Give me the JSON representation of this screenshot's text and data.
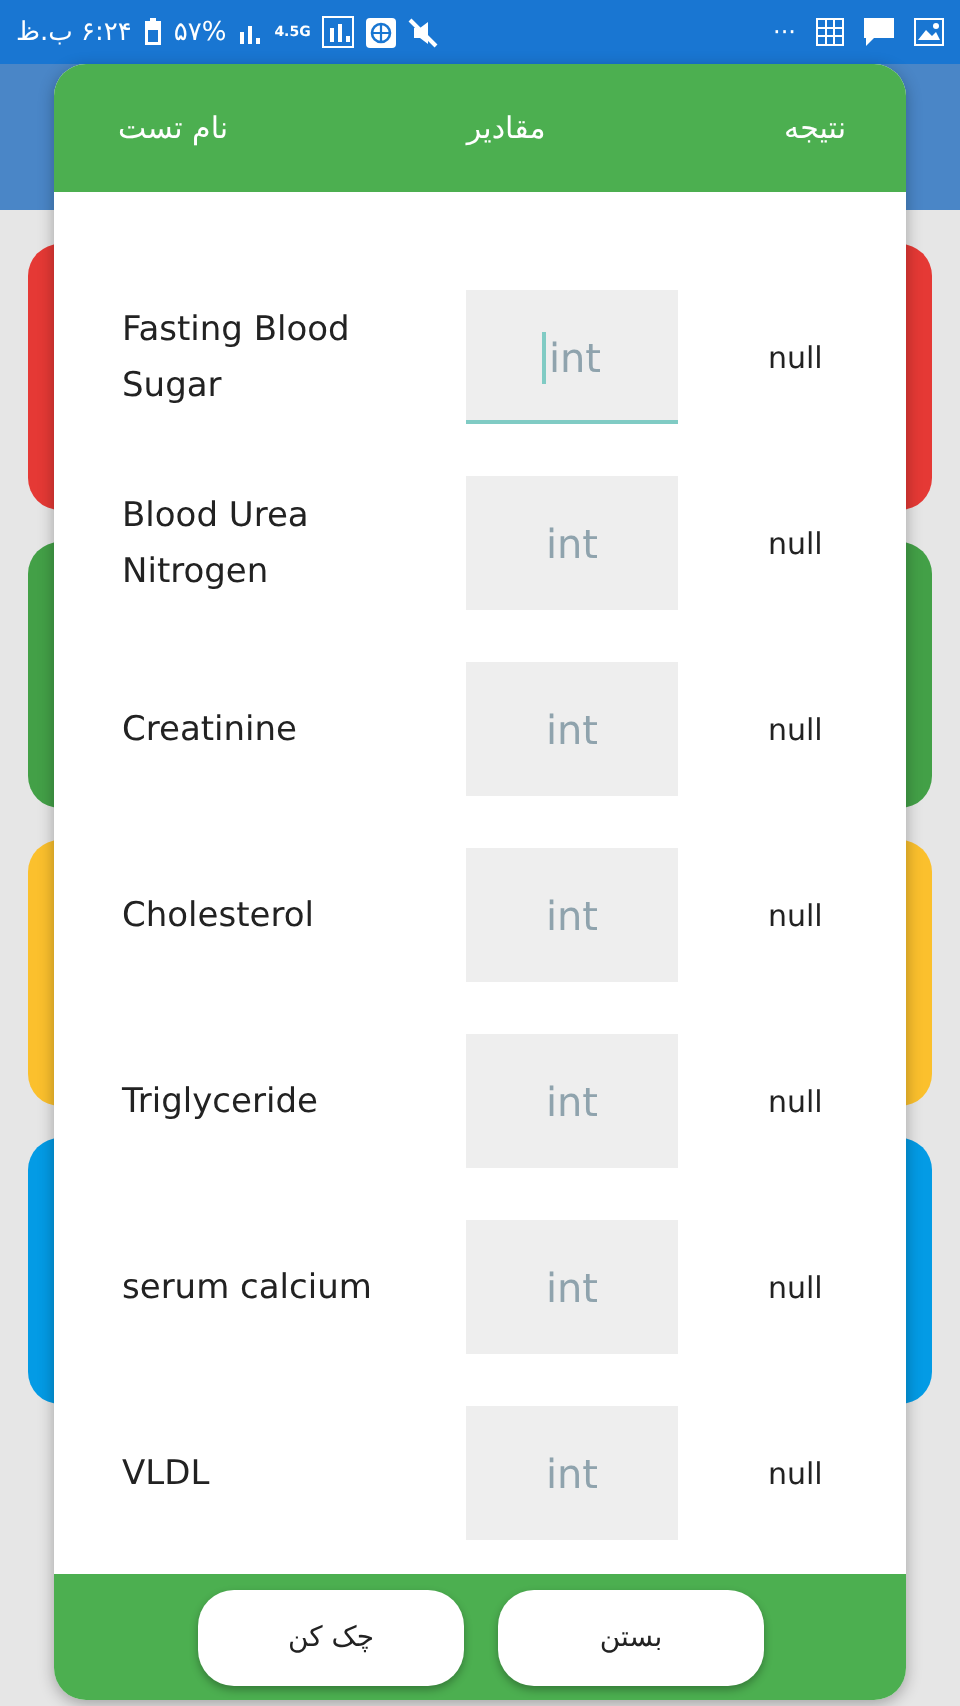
{
  "status_bar": {
    "time": "۶:۲۴ ب.ظ",
    "battery": "۵۷%",
    "network": "4.5G",
    "more": "···"
  },
  "background_cards": [
    {
      "color": "#e53935"
    },
    {
      "color": "#43a047"
    },
    {
      "color": "#fbc02d"
    },
    {
      "color": "#039be5"
    }
  ],
  "dialog": {
    "columns": [
      "نتیجه",
      "مقادیر",
      "نام تست"
    ],
    "rows": [
      {
        "name": "Fasting Blood Sugar",
        "placeholder": "int",
        "focused": true,
        "result": "null"
      },
      {
        "name": "Blood Urea Nitrogen",
        "placeholder": "int",
        "focused": false,
        "result": "null"
      },
      {
        "name": "Creatinine",
        "placeholder": "int",
        "focused": false,
        "result": "null"
      },
      {
        "name": "Cholesterol",
        "placeholder": "int",
        "focused": false,
        "result": "null"
      },
      {
        "name": "Triglyceride",
        "placeholder": "int",
        "focused": false,
        "result": "null"
      },
      {
        "name": "serum calcium",
        "placeholder": "int",
        "focused": false,
        "result": "null"
      },
      {
        "name": "VLDL",
        "placeholder": "int",
        "focused": false,
        "result": "null"
      }
    ],
    "buttons": [
      "بستن",
      "چک کن"
    ]
  }
}
